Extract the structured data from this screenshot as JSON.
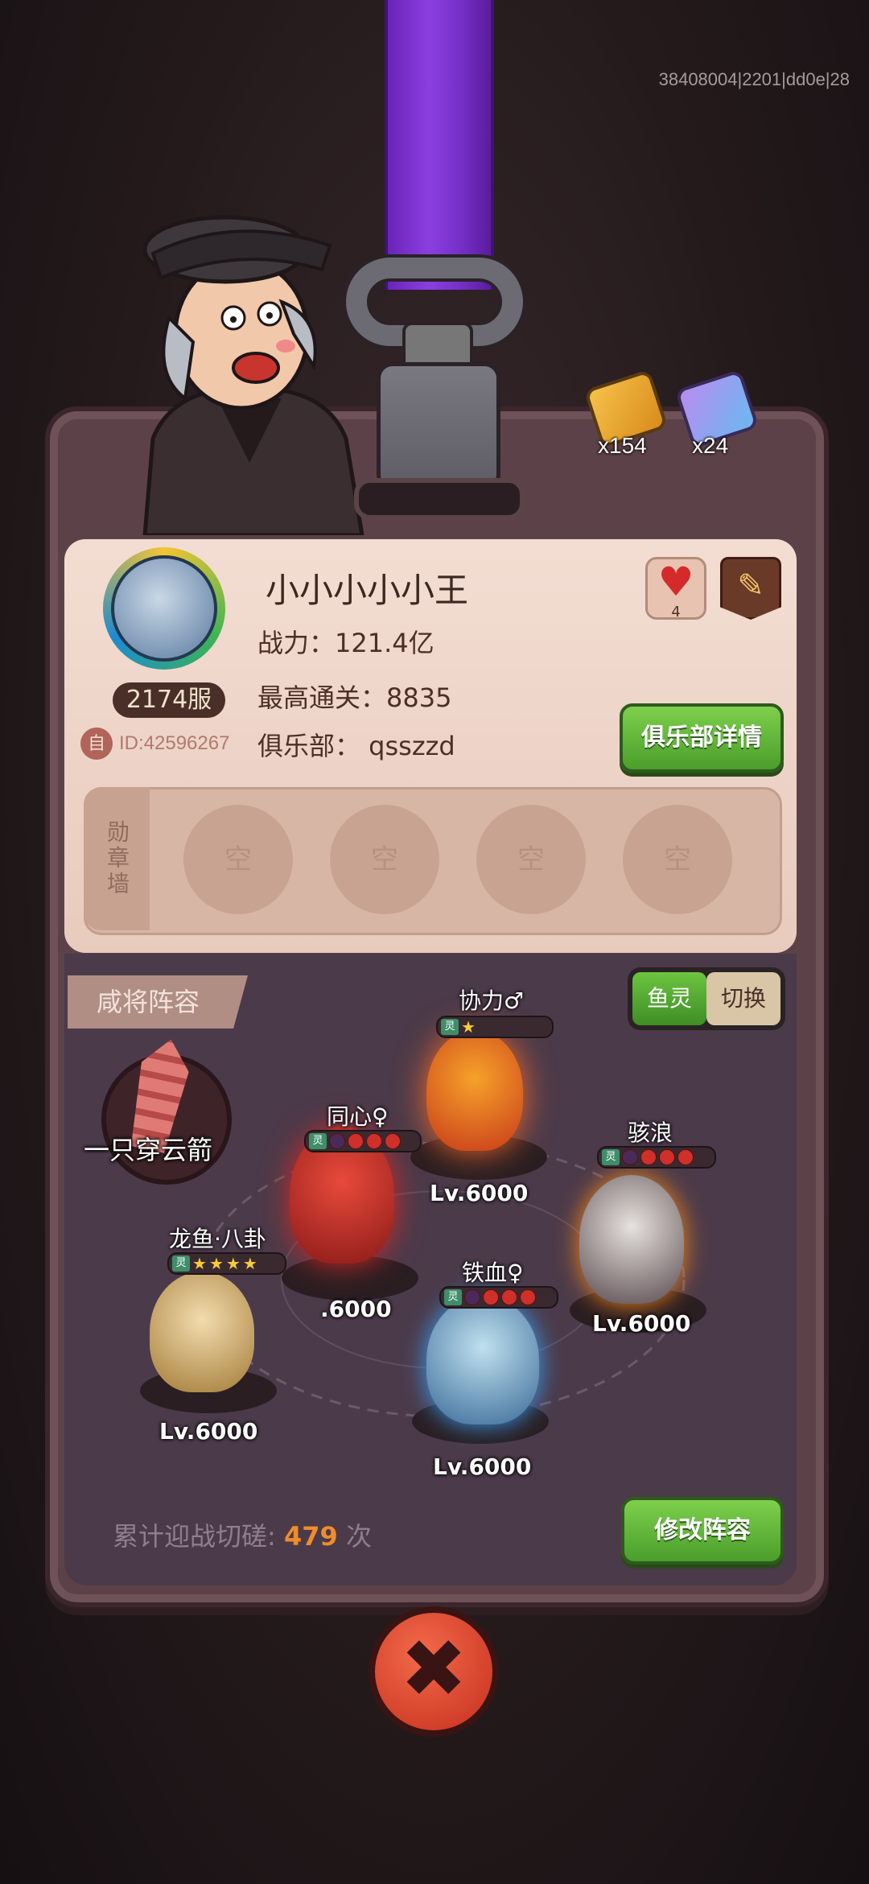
{
  "build_id": "38408004|2201|dd0e|28",
  "currencies": [
    {
      "icon": "gold-bar-icon",
      "amount": "x154"
    },
    {
      "icon": "crystal-icon",
      "amount": "x24"
    }
  ],
  "profile": {
    "name": "小小小小小王",
    "power": "战力：121.4亿",
    "best_clear": "最高通关：8835",
    "club": "俱乐部：  qsszzd",
    "server": "2174服",
    "id_icon": "自",
    "id": "ID:42596267",
    "likes": "4",
    "club_button": "俱乐部详情"
  },
  "medal_wall": {
    "label": "勋章墙",
    "slots": [
      "空",
      "空",
      "空",
      "空"
    ]
  },
  "lineup": {
    "title": "咸将阵容",
    "toggle_on": "鱼灵",
    "toggle_off": "切换",
    "artifact": "一只穿云箭",
    "tag": "灵",
    "heroes": [
      {
        "name": "协力♂",
        "level": "Lv.6000",
        "stars": 1
      },
      {
        "name": "同心♀",
        "level": ".6000",
        "stars": 0
      },
      {
        "name": "骇浪",
        "level": "Lv.6000",
        "stars": 0
      },
      {
        "name": "龙鱼·八卦",
        "level": "Lv.6000",
        "stars": 4
      },
      {
        "name": "铁血♀",
        "level": "Lv.6000",
        "stars": 0
      }
    ],
    "challenge_prefix": "累计迎战切磋:",
    "challenge_count": "479",
    "challenge_suffix": "次",
    "edit_button": "修改阵容"
  },
  "close_icon": "✖"
}
